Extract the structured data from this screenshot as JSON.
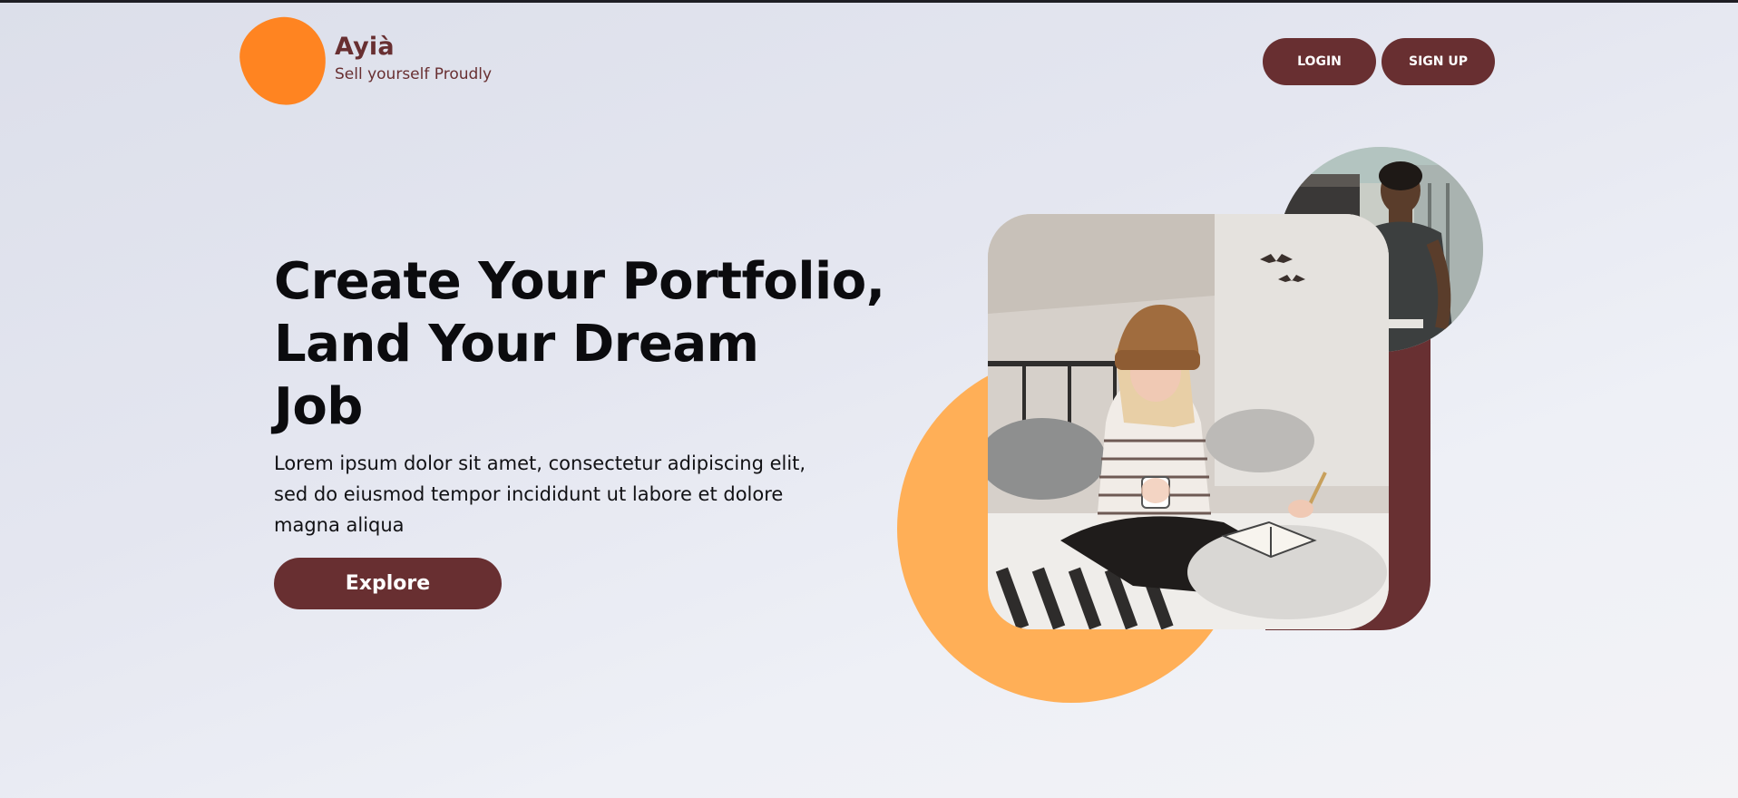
{
  "header": {
    "brand_name": "Ayià",
    "tagline": "Sell yourself Proudly",
    "logo_icon": "orange-blob-logo",
    "login_label": "LOGIN",
    "signup_label": "SIGN UP"
  },
  "hero": {
    "title_line1": "Create Your Portfolio,",
    "title_line2": "Land Your Dream",
    "title_line3": "Job",
    "description_line1": "Lorem ipsum dolor sit amet, consectetur adipiscing elit,",
    "description_line2": "sed do eiusmod tempor incididunt ut labore et dolore",
    "description_line3": "magna aliqua",
    "explore_label": "Explore",
    "main_image": "woman-reading-on-bed-photo",
    "secondary_image": "man-at-office-desk-photo"
  },
  "colors": {
    "brand_maroon": "#682f31",
    "logo_orange": "#ff8421",
    "accent_orange": "#ffaf57",
    "heading_text": "#0b0b0e"
  }
}
